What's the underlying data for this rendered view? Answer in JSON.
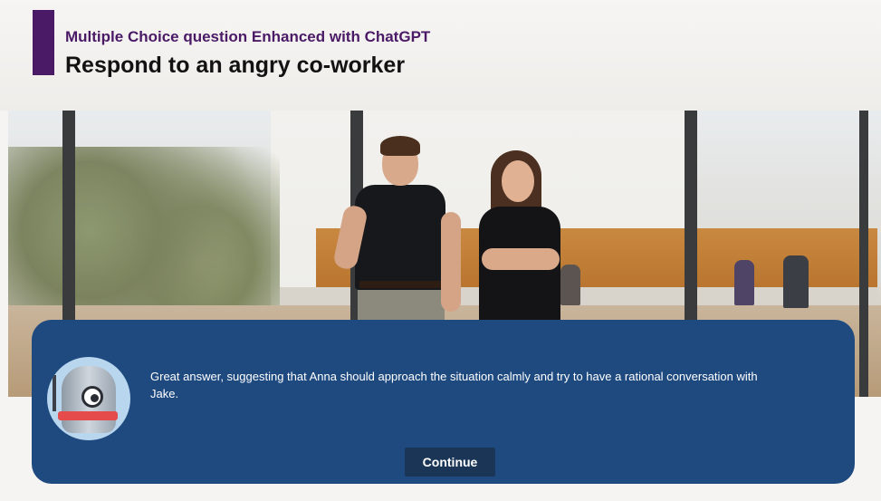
{
  "header": {
    "subtitle": "Multiple Choice question Enhanced with ChatGPT",
    "title": "Respond to an angry co-worker"
  },
  "scene": {
    "description_icon": "office-scene-image"
  },
  "feedback": {
    "avatar_icon": "robot-icon",
    "text": "Great answer, suggesting that Anna should approach the situation calmly and try to have a rational conversation with Jake.",
    "continue_label": "Continue"
  },
  "colors": {
    "accent": "#4a1a66",
    "panel": "#1e4a80",
    "button": "#1a3556"
  }
}
